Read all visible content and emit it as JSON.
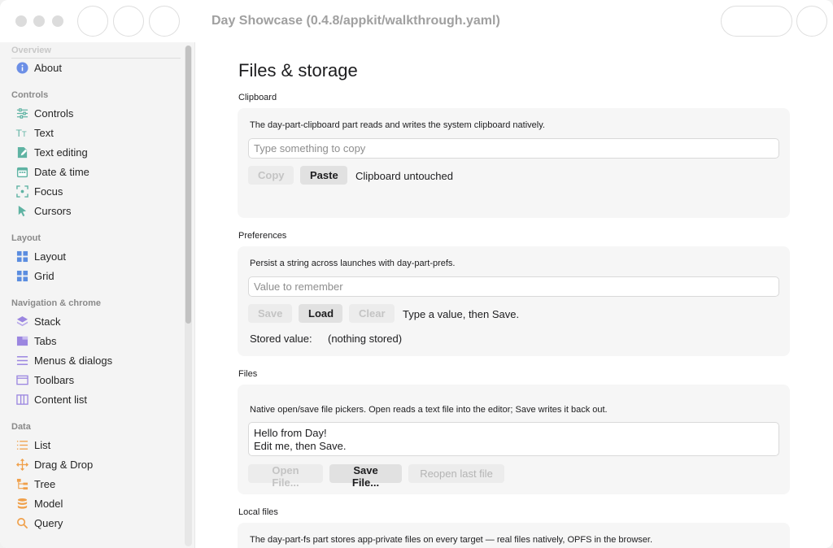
{
  "window": {
    "title": "Day Showcase (0.4.8/appkit/walkthrough.yaml)"
  },
  "sidebar": {
    "faded_header": "Overview",
    "sections": [
      {
        "label": "Controls"
      },
      {
        "label": "Layout"
      },
      {
        "label": "Navigation & chrome"
      },
      {
        "label": "Data"
      }
    ],
    "items": [
      {
        "label": "About",
        "icon": "info-icon"
      },
      {
        "label": "Controls",
        "icon": "sliders-icon"
      },
      {
        "label": "Text",
        "icon": "text-icon"
      },
      {
        "label": "Text editing",
        "icon": "edit-document-icon"
      },
      {
        "label": "Date & time",
        "icon": "calendar-icon"
      },
      {
        "label": "Focus",
        "icon": "focus-icon"
      },
      {
        "label": "Cursors",
        "icon": "cursor-icon"
      },
      {
        "label": "Layout",
        "icon": "layout-grid-icon"
      },
      {
        "label": "Grid",
        "icon": "grid-icon"
      },
      {
        "label": "Stack",
        "icon": "stack-icon"
      },
      {
        "label": "Tabs",
        "icon": "tabs-icon"
      },
      {
        "label": "Menus & dialogs",
        "icon": "menu-lines-icon"
      },
      {
        "label": "Toolbars",
        "icon": "window-icon"
      },
      {
        "label": "Content list",
        "icon": "columns-icon"
      },
      {
        "label": "List",
        "icon": "list-icon"
      },
      {
        "label": "Drag & Drop",
        "icon": "move-icon"
      },
      {
        "label": "Tree",
        "icon": "tree-icon"
      },
      {
        "label": "Model",
        "icon": "database-icon"
      },
      {
        "label": "Query",
        "icon": "search-icon"
      }
    ]
  },
  "main": {
    "title": "Files & storage",
    "clipboard": {
      "label": "Clipboard",
      "description": "The day-part-clipboard part reads and writes the system clipboard natively.",
      "input_placeholder": "Type something to copy",
      "copy_label": "Copy",
      "paste_label": "Paste",
      "status": "Clipboard untouched"
    },
    "preferences": {
      "label": "Preferences",
      "description": "Persist a string across launches with day-part-prefs.",
      "input_placeholder": "Value to remember",
      "save_label": "Save",
      "load_label": "Load",
      "clear_label": "Clear",
      "status": "Type a value, then Save.",
      "stored_label": "Stored value:",
      "stored_value": "(nothing stored)"
    },
    "files": {
      "label": "Files",
      "description": "Native open/save file pickers. Open reads a text file into the editor; Save writes it back out.",
      "editor_line1": "Hello from Day!",
      "editor_line2": "Edit me, then Save.",
      "open_label": "Open File...",
      "save_label": "Save File...",
      "reopen_label": "Reopen last file"
    },
    "local_files": {
      "label": "Local files",
      "description": "The day-part-fs part stores app-private files on every target — real files natively, OPFS in the browser."
    }
  },
  "colors": {
    "accent_blue": "#6c8fe6",
    "green": "#5fb3a3",
    "blue_grid": "#5b8de0",
    "purple": "#9b86e0",
    "orange": "#f0a04a"
  }
}
